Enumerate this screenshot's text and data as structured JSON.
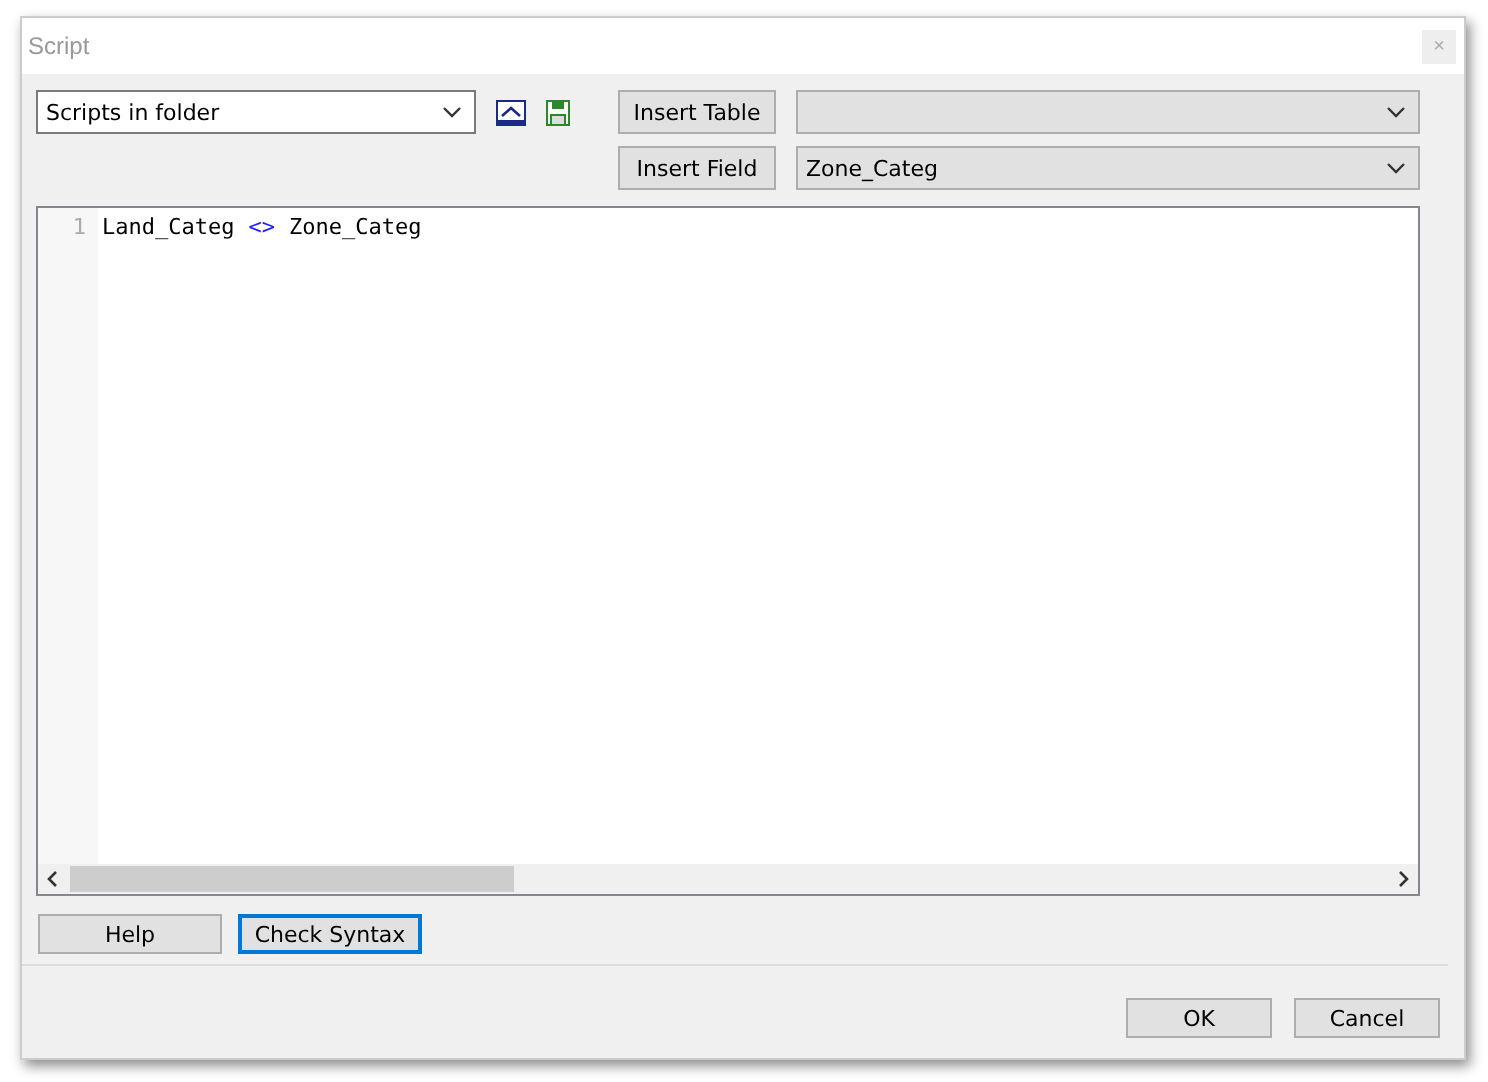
{
  "window": {
    "title": "Script",
    "close": "×"
  },
  "scripts_dropdown": {
    "value": "Scripts in folder"
  },
  "buttons_top": [
    {
      "label": "Insert Table"
    },
    {
      "label": "Insert Field"
    }
  ],
  "field_dropdown": {
    "value": "Zone_Categ"
  },
  "editor": {
    "lines": [
      {
        "number": "1",
        "tokens": [
          {
            "kind": "identifier",
            "text": "Land_Categ"
          },
          {
            "kind": "operator",
            "text": "<>"
          },
          {
            "kind": "identifier",
            "text": "Zone_Categ"
          }
        ]
      }
    ]
  },
  "bottom_buttons": [
    {
      "label": "Help",
      "focused": false
    },
    {
      "label": "Check Syntax",
      "focused": true
    }
  ],
  "dialog_buttons": [
    {
      "label": "OK"
    },
    {
      "label": "Cancel"
    }
  ]
}
